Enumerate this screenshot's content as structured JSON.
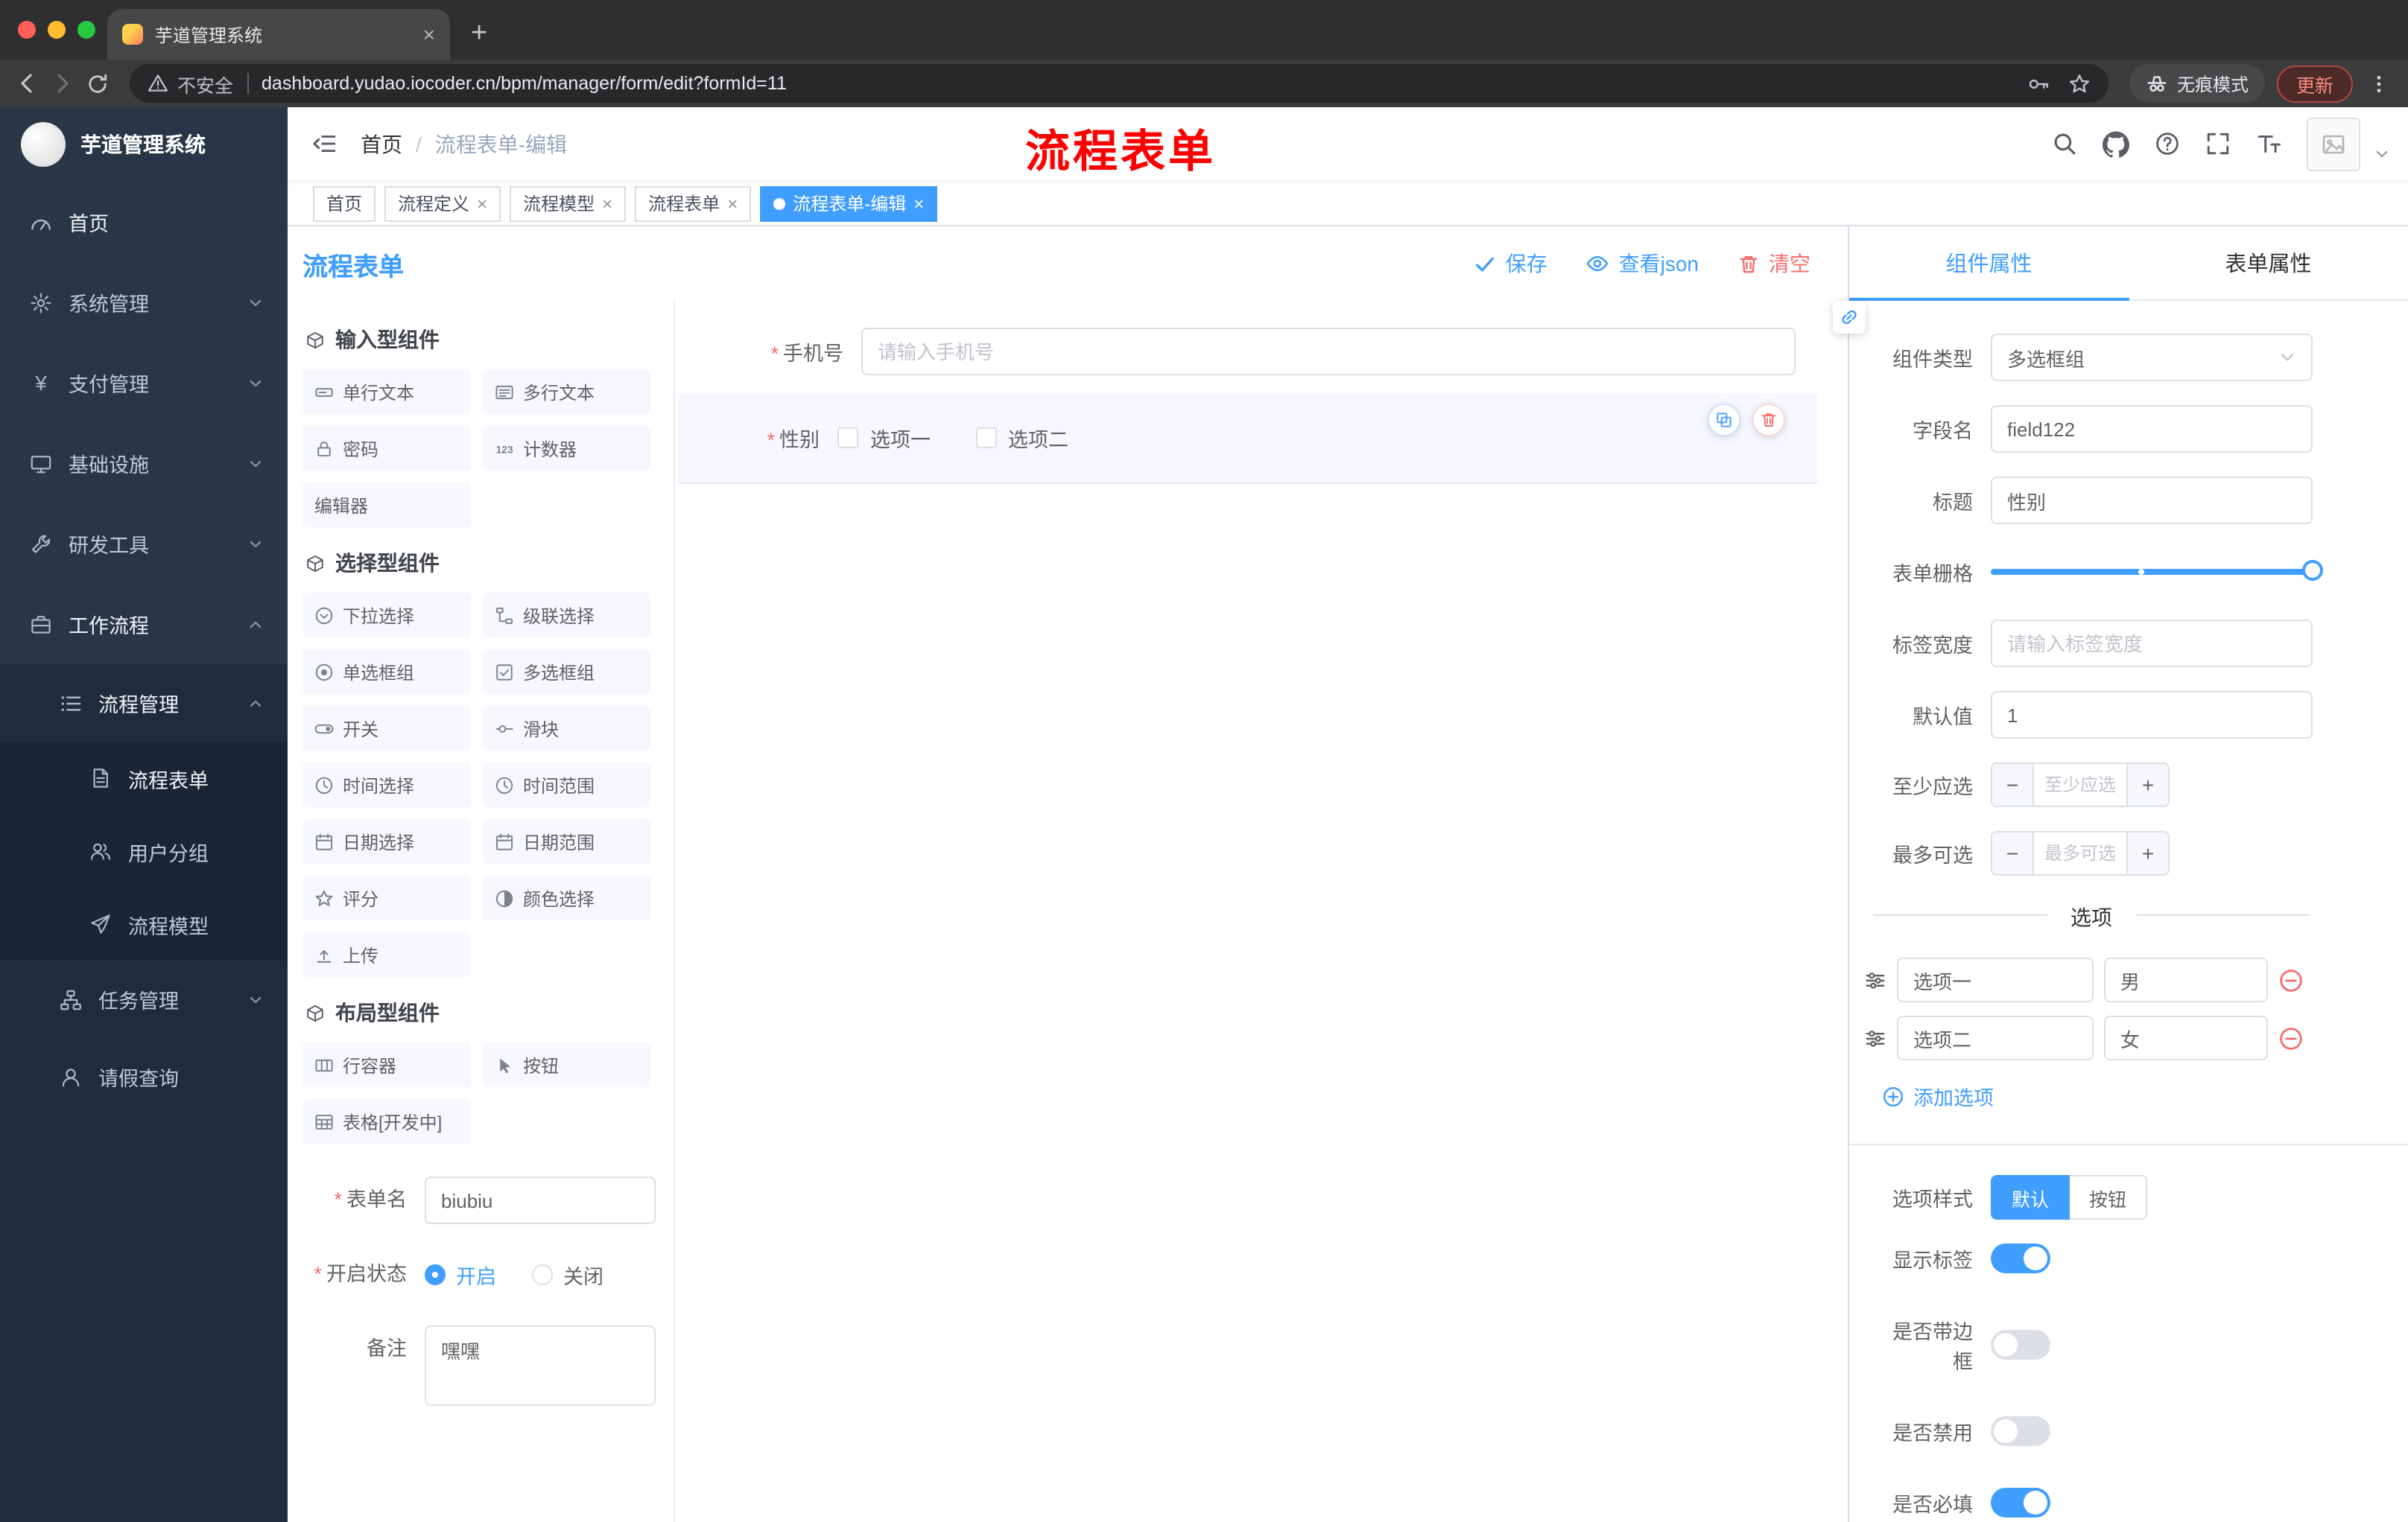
{
  "browser": {
    "tab_title": "芋道管理系统",
    "security_label": "不安全",
    "url": "dashboard.yudao.iocoder.cn/bpm/manager/form/edit?formId=11",
    "incognito_label": "无痕模式",
    "update_label": "更新"
  },
  "header": {
    "breadcrumb_home": "首页",
    "breadcrumb_sep": "/",
    "breadcrumb_current": "流程表单-编辑",
    "annotation": "流程表单"
  },
  "tags": [
    {
      "label": "首页"
    },
    {
      "label": "流程定义"
    },
    {
      "label": "流程模型"
    },
    {
      "label": "流程表单"
    },
    {
      "label": "流程表单-编辑"
    }
  ],
  "sidebar": {
    "logo_title": "芋道管理系统",
    "items": [
      {
        "label": "首页"
      },
      {
        "label": "系统管理"
      },
      {
        "label": "支付管理"
      },
      {
        "label": "基础设施"
      },
      {
        "label": "研发工具"
      },
      {
        "label": "工作流程"
      },
      {
        "label": "流程管理"
      },
      {
        "label": "流程表单"
      },
      {
        "label": "用户分组"
      },
      {
        "label": "流程模型"
      },
      {
        "label": "任务管理"
      },
      {
        "label": "请假查询"
      }
    ]
  },
  "designer": {
    "page_title": "流程表单",
    "actions": {
      "save": "保存",
      "view_json": "查看json",
      "clear": "清空"
    },
    "palette": {
      "groups": [
        {
          "title": "输入型组件",
          "items": [
            "单行文本",
            "多行文本",
            "密码",
            "计数器",
            "编辑器"
          ]
        },
        {
          "title": "选择型组件",
          "items": [
            "下拉选择",
            "级联选择",
            "单选框组",
            "多选框组",
            "开关",
            "滑块",
            "时间选择",
            "时间范围",
            "日期选择",
            "日期范围",
            "评分",
            "颜色选择",
            "上传"
          ]
        },
        {
          "title": "布局型组件",
          "items": [
            "行容器",
            "按钮",
            "表格[开发中]"
          ]
        }
      ]
    },
    "meta": {
      "form_name_label": "表单名",
      "form_name_value": "biubiu",
      "status_label": "开启状态",
      "status_on": "开启",
      "status_off": "关闭",
      "remark_label": "备注",
      "remark_value": "嘿嘿"
    },
    "canvas": {
      "phone_label": "手机号",
      "phone_placeholder": "请输入手机号",
      "gender_label": "性别",
      "gender_option1": "选项一",
      "gender_option2": "选项二"
    }
  },
  "props": {
    "tabs": {
      "component": "组件属性",
      "form": "表单属性"
    },
    "component_type_label": "组件类型",
    "component_type_value": "多选框组",
    "field_name_label": "字段名",
    "field_name_value": "field122",
    "title_label": "标题",
    "title_value": "性别",
    "grid_label": "表单栅格",
    "label_width_label": "标签宽度",
    "label_width_placeholder": "请输入标签宽度",
    "default_label": "默认值",
    "default_value": "1",
    "min_label": "至少应选",
    "min_placeholder": "至少应选",
    "max_label": "最多可选",
    "max_placeholder": "最多可选",
    "options_divider": "选项",
    "options": [
      {
        "label": "选项一",
        "value": "男"
      },
      {
        "label": "选项二",
        "value": "女"
      }
    ],
    "add_option": "添加选项",
    "option_style_label": "选项样式",
    "option_style_default": "默认",
    "option_style_button": "按钮",
    "show_label_label": "显示标签",
    "border_label": "是否带边框",
    "disabled_label": "是否禁用",
    "required_label": "是否必填"
  },
  "colors": {
    "primary": "#409eff",
    "danger": "#f56c6c",
    "annotation_red": "#fe0000"
  }
}
